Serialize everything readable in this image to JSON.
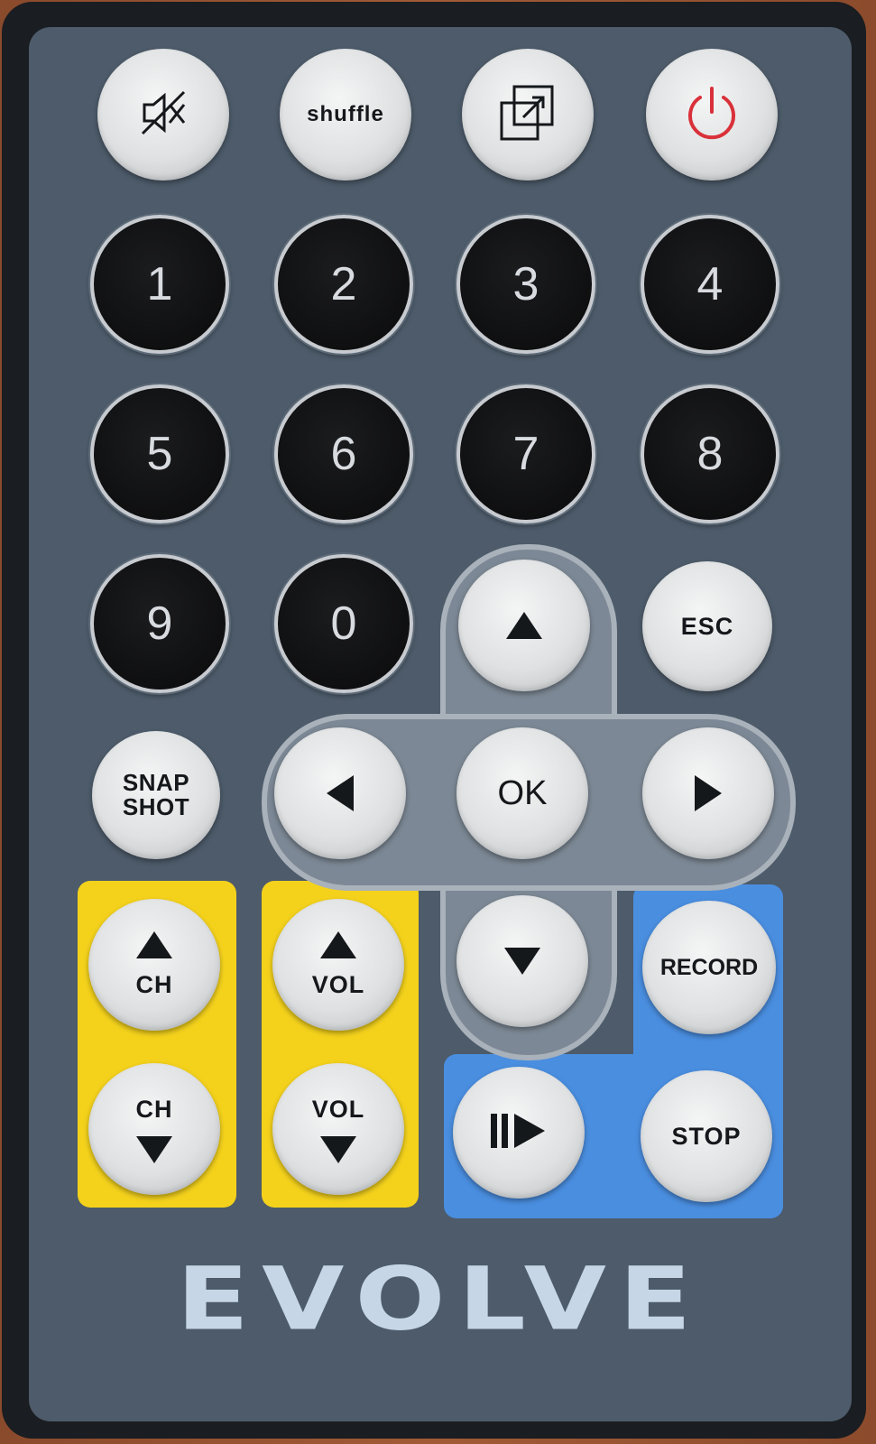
{
  "remote": {
    "brand": "EVOLVE",
    "colors": {
      "face": "#4d5b6a",
      "channel_volume_panel": "#f4d21c",
      "record_panel": "#4a8ee0",
      "power_icon": "#d9313a"
    },
    "top_row": {
      "mute_icon": "mute-icon",
      "shuffle_label": "shuffle",
      "resize_icon": "resize-window-icon",
      "power_icon": "power-icon"
    },
    "digits": [
      "1",
      "2",
      "3",
      "4",
      "5",
      "6",
      "7",
      "8",
      "9",
      "0"
    ],
    "esc_label": "ESC",
    "snapshot_label_line1": "SNAP",
    "snapshot_label_line2": "SHOT",
    "ok_label": "OK",
    "ch_label": "CH",
    "vol_label": "VOL",
    "record_label": "RECORD",
    "stop_label": "STOP",
    "play_pause_icon": "play-pause-icon"
  }
}
